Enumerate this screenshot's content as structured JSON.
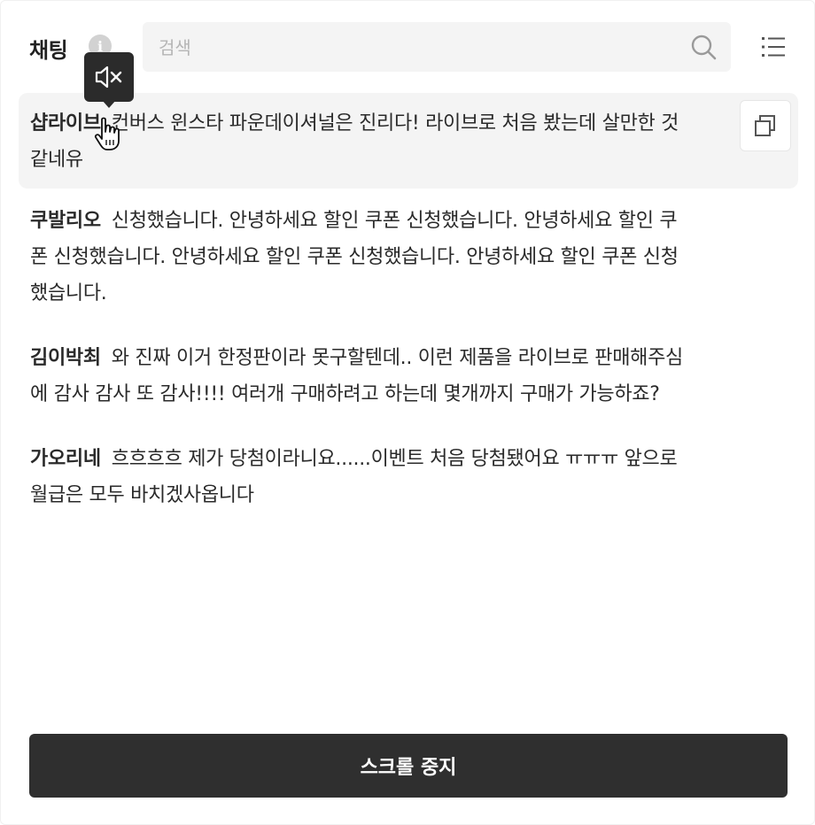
{
  "header": {
    "title": "채팅",
    "info_icon": "info-icon",
    "search_placeholder": "검색",
    "search_value": "",
    "search_icon": "search-icon",
    "list_icon": "list-icon"
  },
  "tooltip": {
    "icon": "mute-icon"
  },
  "messages": [
    {
      "user": "샵라이브",
      "text": "컨버스 윈스타 파운데이셔널은 진리다! 라이브로 처음 봤는데 살만한 것 같네유",
      "highlighted": true
    },
    {
      "user": "쿠발리오",
      "text": "신청했습니다. 안녕하세요 할인 쿠폰 신청했습니다. 안녕하세요 할인 쿠폰 신청했습니다. 안녕하세요 할인 쿠폰 신청했습니다. 안녕하세요 할인 쿠폰 신청했습니다."
    },
    {
      "user": "김이박최",
      "text": "와 진짜 이거 한정판이라 못구할텐데.. 이런 제품을 라이브로 판매해주심에 감사 감사 또 감사!!!! 여러개 구매하려고 하는데 몇개까지 구매가 가능하죠?"
    },
    {
      "user": "가오리네",
      "text": "흐흐흐흐 제가 당첨이라니요......이벤트 처음 당첨됐어요 ㅠㅠㅠ 앞으로 월급은 모두 바치겠사옵니다"
    }
  ],
  "copy_icon": "copy-icon",
  "stop_button_label": "스크롤 중지",
  "colors": {
    "button_bg": "#2f2f2f",
    "highlight_bg": "#f4f4f4",
    "tooltip_bg": "#2b2b2b"
  }
}
